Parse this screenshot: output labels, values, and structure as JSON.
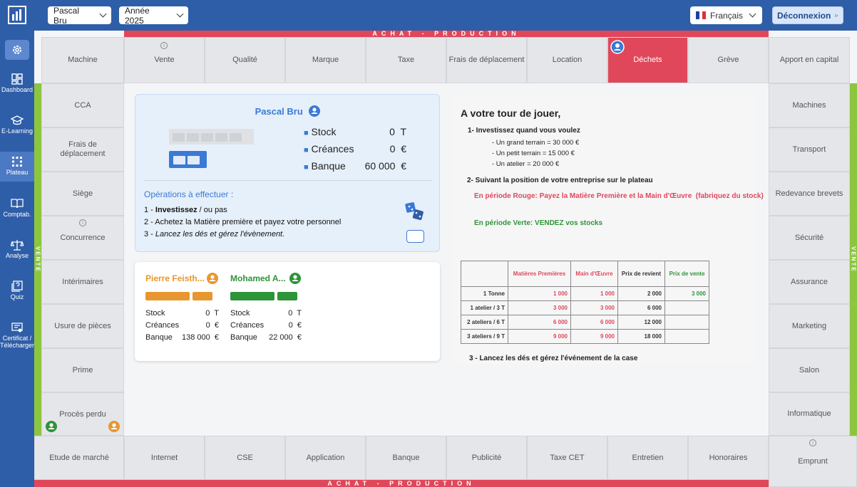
{
  "header": {
    "player_select": "Pascal Bru",
    "year_select": "Année 2025",
    "language": "Français",
    "logout": "Déconnexion"
  },
  "nav": [
    {
      "label": "Dashboard"
    },
    {
      "label": "E-Learning"
    },
    {
      "label": "Plateau"
    },
    {
      "label": "Comptab."
    },
    {
      "label": "Analyse"
    },
    {
      "label": "Quiz"
    },
    {
      "label": "Certificat / Télécharger"
    }
  ],
  "board": {
    "stripe_top": "ACHAT - PRODUCTION",
    "stripe_bottom": "ACHAT - PRODUCTION",
    "side_label": "VENTE",
    "top": [
      "Machine",
      "Vente",
      "Qualité",
      "Marque",
      "Taxe",
      "Frais de déplacement",
      "Location",
      "Déchets",
      "Grève",
      "Apport en capital"
    ],
    "left": [
      "CCA",
      "Frais de déplacement",
      "Siège",
      "Concurrence",
      "Intérimaires",
      "Usure de pièces",
      "Prime",
      "Procès perdu"
    ],
    "right": [
      "Machines",
      "Transport",
      "Redevance brevets",
      "Sécurité",
      "Assurance",
      "Marketing",
      "Salon",
      "Informatique"
    ],
    "bottom": [
      "Etude de marché",
      "Internet",
      "CSE",
      "Application",
      "Banque",
      "Publicité",
      "Taxe CET",
      "Entretien",
      "Honoraires",
      "Emprunt"
    ]
  },
  "player": {
    "name": "Pascal Bru",
    "stock_label": "Stock",
    "stock": "0",
    "stock_unit": "T",
    "creances_label": "Créances",
    "creances": "0",
    "creances_unit": "€",
    "banque_label": "Banque",
    "banque": "60 000",
    "banque_unit": "€",
    "ops_title": "Opérations à effectuer :",
    "op1_a": "1 - ",
    "op1_b": "Investissez",
    "op1_c": " / ou pas",
    "op2": "2 - Achetez la Matière première et payez votre personnel",
    "op3_a": "3 - ",
    "op3_b": "Lancez les dés et gérez l'évènement."
  },
  "others": [
    {
      "name": "Pierre Feisth...",
      "color": "#e8962f",
      "stock": "0",
      "stock_unit": "T",
      "creances": "0",
      "creances_unit": "€",
      "banque": "138 000",
      "banque_unit": "€"
    },
    {
      "name": "Mohamed A...",
      "color": "#2e9438",
      "stock": "0",
      "stock_unit": "T",
      "creances": "0",
      "creances_unit": "€",
      "banque": "22 000",
      "banque_unit": "€"
    }
  ],
  "others_labels": {
    "stock": "Stock",
    "creances": "Créances",
    "banque": "Banque"
  },
  "instructions": {
    "title": "A votre tour de jouer,",
    "s1": "1- Investissez quand vous voulez",
    "s1a": "- Un grand terrain = 30 000 €",
    "s1b": "- Un petit terrain = 15 000 €",
    "s1c": "- Un atelier = 20 000 €",
    "s2": "2- Suivant la position de votre entreprise sur le plateau",
    "red": "En période Rouge: Payez la Matière Première et la Main d'Œuvre  (fabriquez du stock)",
    "green": "En période Verte: VENDEZ vos stocks",
    "s3": "3 - Lancez les dés et gérez l'événement de la case"
  },
  "table": {
    "headers": [
      "",
      "Matières Premières",
      "Main d'Œuvre",
      "Prix de revient",
      "Prix de vente"
    ],
    "rows": [
      [
        "1 Tonne",
        "1 000",
        "1 000",
        "2 000",
        "3 000"
      ],
      [
        "1 atelier / 3 T",
        "3 000",
        "3 000",
        "6 000",
        ""
      ],
      [
        "2 ateliers / 6 T",
        "6 000",
        "6 000",
        "12 000",
        ""
      ],
      [
        "3 ateliers / 9 T",
        "9 000",
        "9 000",
        "18 000",
        ""
      ]
    ]
  },
  "colors": {
    "primary": "#2f5ea8",
    "red": "#e0475a",
    "green": "#8cc63f",
    "player_blue": "#3a7ad5"
  }
}
